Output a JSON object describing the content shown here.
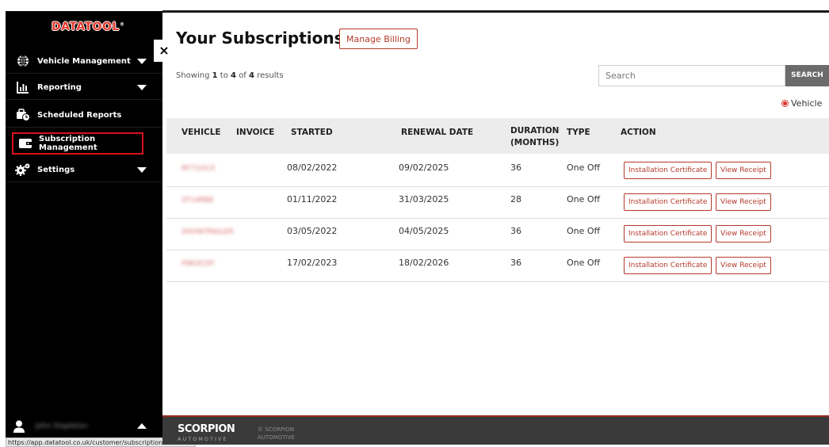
{
  "sidebar": {
    "logo": "DATATOOL",
    "logo_mark": "®",
    "close_label": "×",
    "items": [
      {
        "label": "Vehicle Management",
        "icon": "globe-icon",
        "has_caret": true
      },
      {
        "label": "Reporting",
        "icon": "bar-chart-icon",
        "has_caret": true
      },
      {
        "label": "Scheduled Reports",
        "icon": "scheduled-reports-icon",
        "has_caret": false
      },
      {
        "label": "Subscription Management",
        "icon": "wallet-icon",
        "has_caret": false,
        "active": true
      },
      {
        "label": "Settings",
        "icon": "gears-icon",
        "has_caret": true
      }
    ],
    "user_name": "John Stapleton",
    "status_url": "https://app.datatool.co.uk/customer/subscription"
  },
  "main": {
    "title": "Your Subscriptions",
    "manage_billing_label": "Manage Billing",
    "showing": {
      "prefix": "Showing",
      "from": "1",
      "to_word": "to",
      "to": "4",
      "of_word": "of",
      "total": "4",
      "suffix": "results"
    },
    "search": {
      "placeholder": "Search",
      "button_label": "SEARCH"
    },
    "filter_label": "Vehicle",
    "columns": [
      "VEHICLE",
      "INVOICE",
      "STARTED",
      "RENEWAL DATE",
      "DURATION (MONTHS)",
      "TYPE",
      "ACTION"
    ],
    "rows": [
      {
        "vehicle": "RF71OCX",
        "invoice": "",
        "started": "08/02/2022",
        "renewal": "09/02/2025",
        "duration": "36",
        "type": "One Off"
      },
      {
        "vehicle": "ST14RBE",
        "invoice": "",
        "started": "01/11/2022",
        "renewal": "31/03/2025",
        "duration": "28",
        "type": "One Off"
      },
      {
        "vehicle": "SHOWTRAILER",
        "invoice": "",
        "started": "03/05/2022",
        "renewal": "04/05/2025",
        "duration": "36",
        "type": "One Off"
      },
      {
        "vehicle": "FN63CDY",
        "invoice": "",
        "started": "17/02/2023",
        "renewal": "18/02/2026",
        "duration": "36",
        "type": "One Off"
      }
    ],
    "actions": {
      "certificate_label": "Installation Certificate",
      "receipt_label": "View Receipt"
    }
  },
  "footer": {
    "brand": "SCORPION",
    "brand_sub": "AUTOMOTIVE",
    "copyright_line1": "© SCORPION",
    "copyright_line2": "AUTOMOTIVE"
  },
  "colors": {
    "accent": "#b53a2a",
    "sidebar_bg": "#000000",
    "active_border": "#d9111b",
    "footer_bg": "#3a3a3a"
  }
}
